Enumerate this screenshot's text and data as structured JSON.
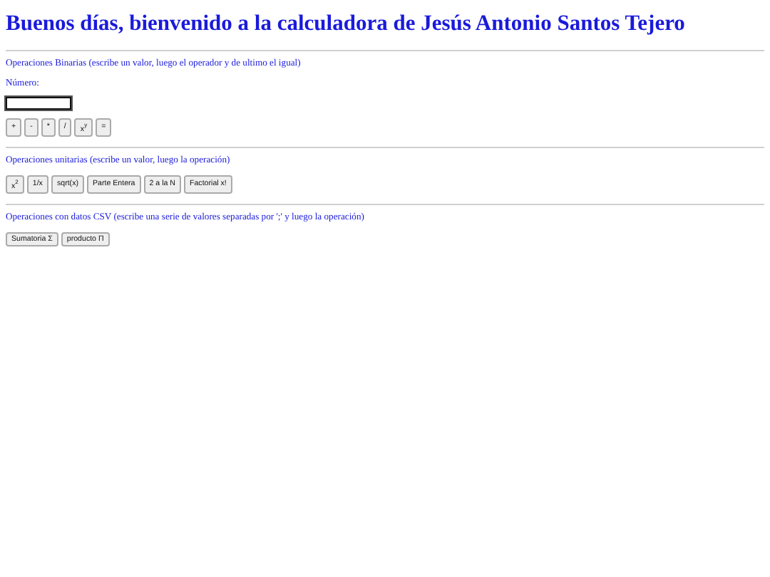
{
  "title": "Buenos días, bienvenido a la calculadora de Jesús Antonio Santos Tejero",
  "sections": [
    {
      "heading": "Operaciones Binarias (escribe un valor, luego el operador y de ultimo el igual)",
      "field": {
        "label": "Número:",
        "focused": true
      },
      "buttons": [
        "+",
        "-",
        "*",
        "/",
        "x$^{y}$",
        "="
      ]
    },
    {
      "heading": "Operaciones unitarias (escribe un valor, luego la operación)",
      "buttons": [
        "x$^{2}$",
        "1/x",
        "sqrt(x)",
        "Parte Entera",
        "2 a la N",
        "Factorial x!"
      ]
    },
    {
      "heading": "Operaciones con datos CSV (escribe una serie de valores separadas por ';' y luego la operación)",
      "buttons": [
        "Sumatoria Σ",
        "producto Π"
      ]
    }
  ]
}
